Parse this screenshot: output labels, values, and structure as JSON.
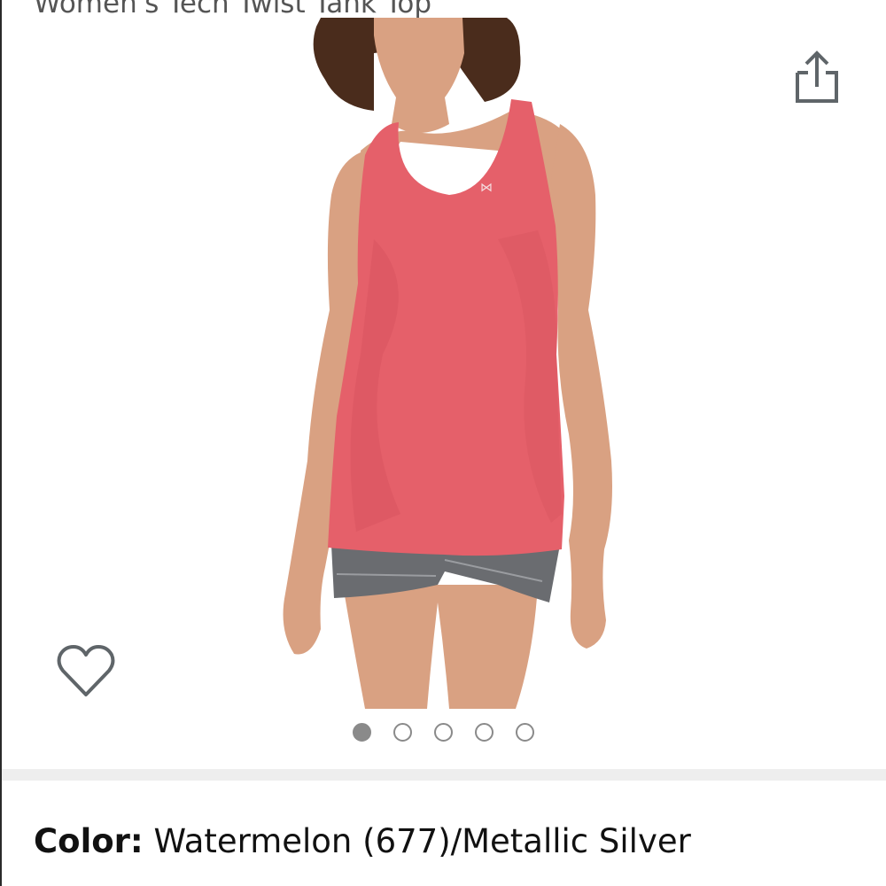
{
  "product": {
    "title": "Women's Tech Twist Tank Top"
  },
  "gallery": {
    "share_icon": "share-icon",
    "wishlist_icon": "heart-outline-icon",
    "image_count": 5,
    "active_index": 0
  },
  "color_selection": {
    "label": "Color:",
    "value": "Watermelon (677)/Metallic Silver"
  },
  "colors": {
    "tank": "#e5606a",
    "tank_shade": "#d24e5a",
    "shorts": "#6a6c70",
    "skin": "#d9a182",
    "hair": "#4a2c1c",
    "icon_gray": "#5f6569",
    "dot_gray": "#8a8a8a"
  }
}
